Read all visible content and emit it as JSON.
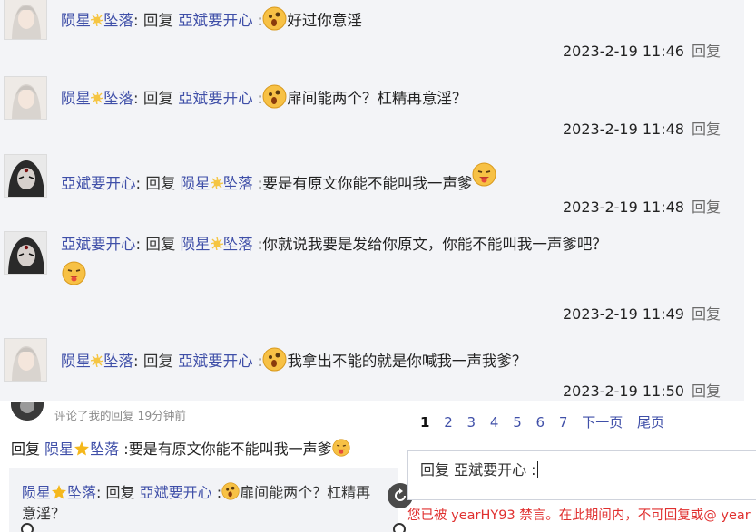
{
  "posts": [
    {
      "author": "陨星",
      "author2": "坠落",
      "verb": "回复",
      "target": "亞斌要开心",
      "text": "好过你意淫",
      "time": "2023-2-19 11:46",
      "reply": "回复"
    },
    {
      "author": "陨星",
      "author2": "坠落",
      "verb": "回复",
      "target": "亞斌要开心",
      "text": "扉间能两个？杠精再意淫？",
      "time": "2023-2-19 11:48",
      "reply": "回复"
    },
    {
      "author": "亞斌要开心",
      "verb": "回复",
      "target": "陨星",
      "target2": "坠落",
      "text": "要是有原文你能不能叫我一声爹",
      "time": "2023-2-19 11:48",
      "reply": "回复"
    },
    {
      "author": "亞斌要开心",
      "verb": "回复",
      "target": "陨星",
      "target2": "坠落",
      "text": "你就说我要是发给你原文，你能不能叫我一声爹吧？",
      "time": "2023-2-19 11:49",
      "reply": "回复"
    },
    {
      "author": "陨星",
      "author2": "坠落",
      "verb": "回复",
      "target": "亞斌要开心",
      "text": "我拿出不能的就是你喊我一声我爹？",
      "time": "2023-2-19 11:50",
      "reply": "回复"
    }
  ],
  "panel": {
    "note": "评论了我的回复 19分钟前",
    "reply_prefix": "回复",
    "reply_user": "陨星",
    "reply_user2": "坠落",
    "reply_text": ":要是有原文你能不能叫我一声爹",
    "quote_user": "陨星",
    "quote_user2": "坠落",
    "quote_verb": ": 回复",
    "quote_target": "亞斌要开心",
    "quote_sep": ":",
    "quote_text": "扉间能两个？杠精再意淫？"
  },
  "pager": {
    "pages": [
      "1",
      "2",
      "3",
      "4",
      "5",
      "6",
      "7"
    ],
    "next": "下一页",
    "last": "尾页",
    "current": "1"
  },
  "reply_box": {
    "text": "回复 亞斌要开心 :"
  },
  "ban_notice": "您已被 yearHY93 禁言。在此期间内，不可回复或@ year",
  "colors": {
    "link": "#3f4fa8",
    "ban": "#e0302f",
    "bg": "#f3f4f7"
  }
}
